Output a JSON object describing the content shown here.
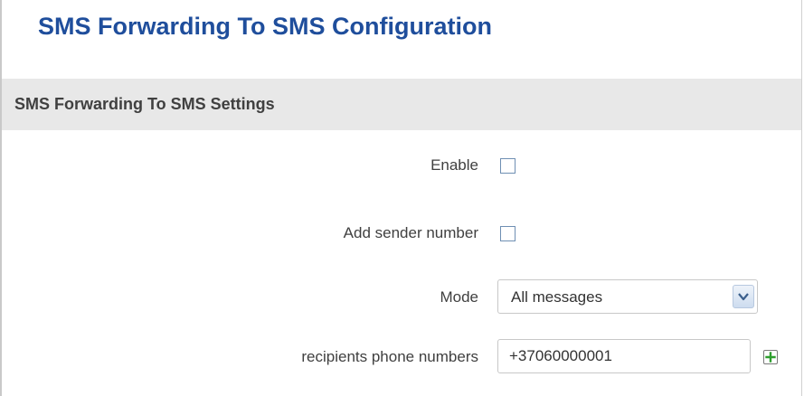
{
  "page": {
    "title": "SMS Forwarding To SMS Configuration"
  },
  "section": {
    "title": "SMS Forwarding To SMS Settings"
  },
  "form": {
    "enable": {
      "label": "Enable",
      "checked": false
    },
    "add_sender_number": {
      "label": "Add sender number",
      "checked": false
    },
    "mode": {
      "label": "Mode",
      "selected": "All messages"
    },
    "recipients": {
      "label": "recipients phone numbers",
      "value": "+37060000001",
      "add_icon": "add-icon"
    }
  },
  "colors": {
    "title": "#1f4e9c",
    "section_bg": "#e8e8e8",
    "label_text": "#404040",
    "add_icon_green": "#2e9e2e"
  }
}
